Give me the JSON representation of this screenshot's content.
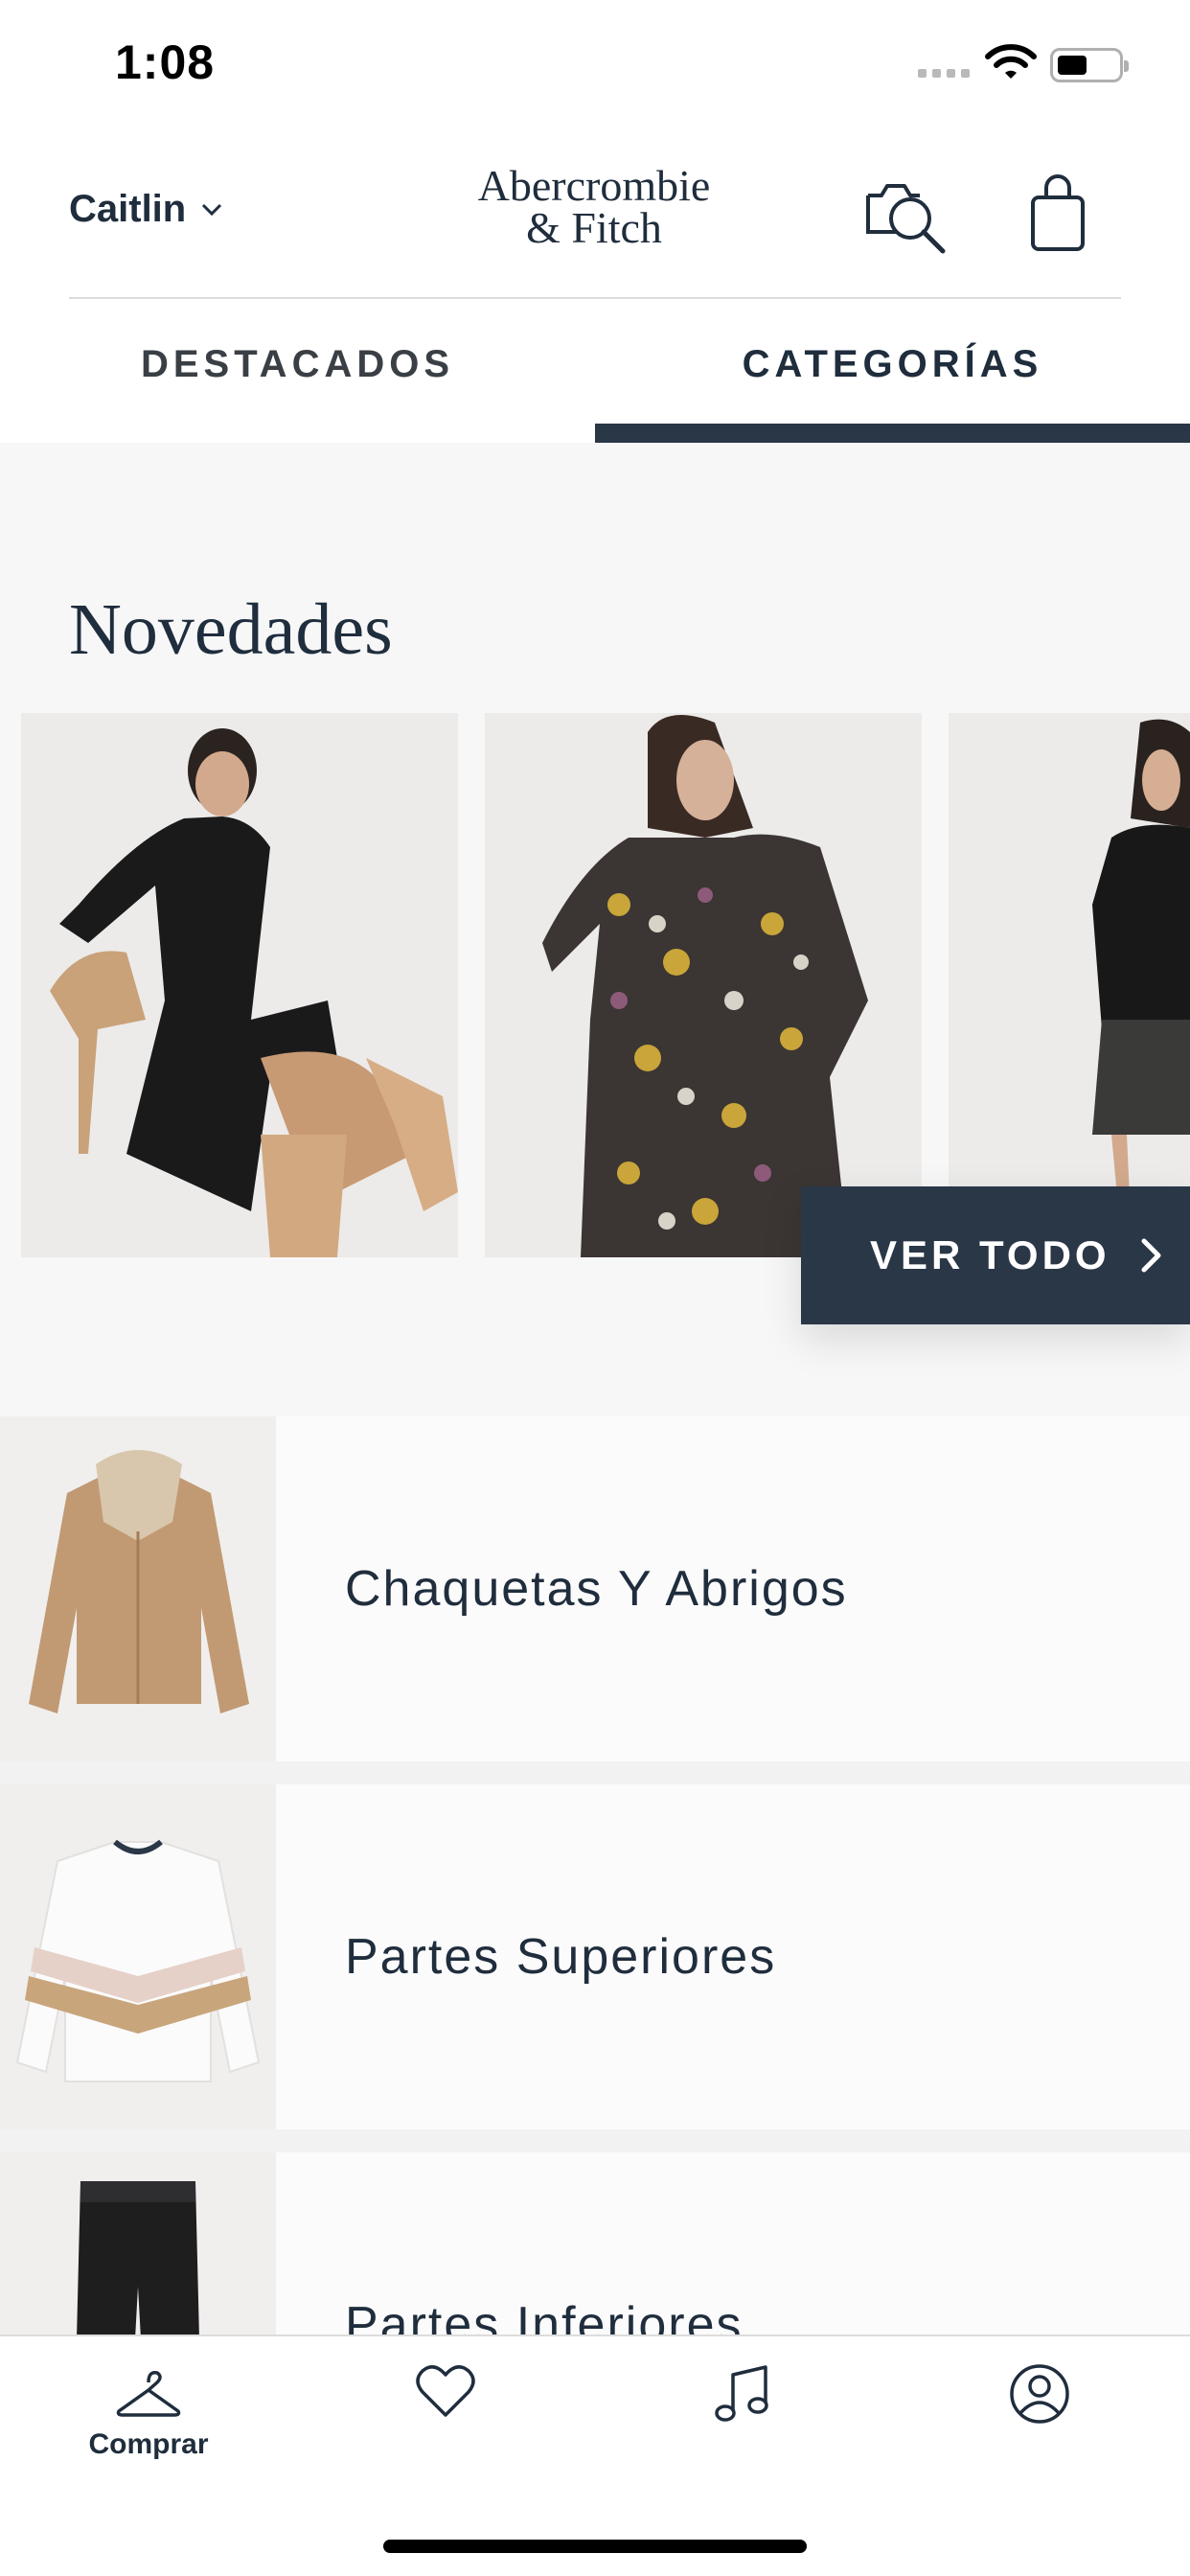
{
  "status_bar": {
    "time": "1:08",
    "icons": [
      "signal-icon",
      "wifi-icon",
      "battery-icon"
    ]
  },
  "header": {
    "account_name": "Caitlin",
    "logo_line1": "Abercrombie",
    "logo_line2": "& Fitch",
    "icons": [
      "chevron-down-icon",
      "camera-search-icon",
      "shopping-bag-icon"
    ]
  },
  "tabs": [
    {
      "label": "DESTACADOS",
      "selected": false
    },
    {
      "label": "CATEGORÍAS",
      "selected": true
    }
  ],
  "novedades": {
    "title": "Novedades",
    "products": [
      {
        "image": "black-dress-photo"
      },
      {
        "image": "floral-dress-photo"
      },
      {
        "image": "leather-jacket-photo"
      }
    ],
    "see_all_label": "VER TODO"
  },
  "categories": [
    {
      "label": "Chaquetas Y Abrigos",
      "image": "jacket-photo"
    },
    {
      "label": "Partes Superiores",
      "image": "sweater-photo"
    },
    {
      "label": "Partes Inferiores",
      "image": "jeans-photo"
    }
  ],
  "bottom_nav": [
    {
      "icon": "hanger-icon",
      "label": "Comprar"
    },
    {
      "icon": "heart-icon",
      "label": ""
    },
    {
      "icon": "music-note-icon",
      "label": ""
    },
    {
      "icon": "profile-icon",
      "label": ""
    }
  ],
  "colors": {
    "navy": "#2a3747",
    "text": "#1f2d3d",
    "background": "#f7f7f7"
  }
}
